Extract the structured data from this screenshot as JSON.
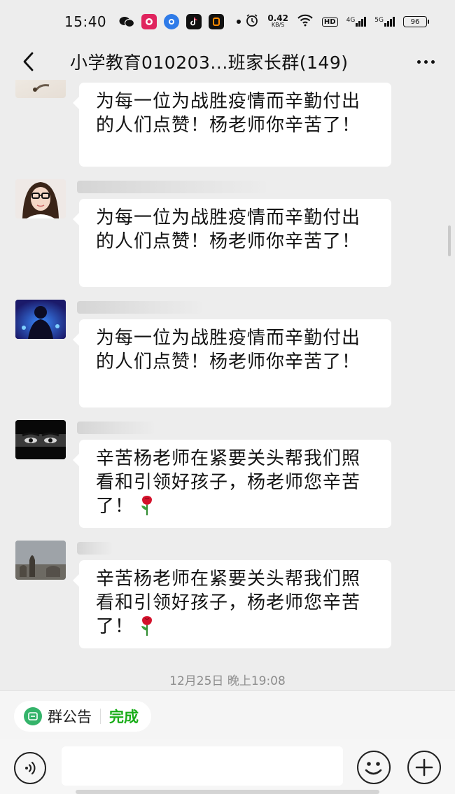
{
  "status_bar": {
    "time": "15:40",
    "net_speed_value": "0.42",
    "net_speed_unit": "KB/S",
    "hd_badge": "HD",
    "signal_1": "4G",
    "signal_2": "5G",
    "battery": "96",
    "app_icons": [
      "wechat-icon",
      "pinduoduo-icon",
      "browser-icon",
      "douyin-icon",
      "kuaishou-icon"
    ]
  },
  "title_bar": {
    "title": "小学教育010203...班家长群(149)"
  },
  "messages": [
    {
      "text": "为每一位为战胜疫情而辛勤付出的人们点赞！杨老师你辛苦了！"
    },
    {
      "text": "为每一位为战胜疫情而辛勤付出的人们点赞！杨老师你辛苦了！"
    },
    {
      "text": "为每一位为战胜疫情而辛勤付出的人们点赞！杨老师你辛苦了！"
    },
    {
      "text": "辛苦杨老师在紧要关头帮我们照看和引领好孩子，杨老师您辛苦了！",
      "emoji": "rose-icon"
    },
    {
      "text": "辛苦杨老师在紧要关头帮我们照看和引领好孩子，杨老师您辛苦了！",
      "emoji": "rose-icon"
    }
  ],
  "timestamp": "12月25日 晚上19:08",
  "notice_bar": {
    "label": "群公告",
    "done": "完成"
  },
  "input_bar": {
    "placeholder": ""
  },
  "colors": {
    "background": "#ededed",
    "bubble": "#ffffff",
    "accent_green": "#1aad19"
  }
}
